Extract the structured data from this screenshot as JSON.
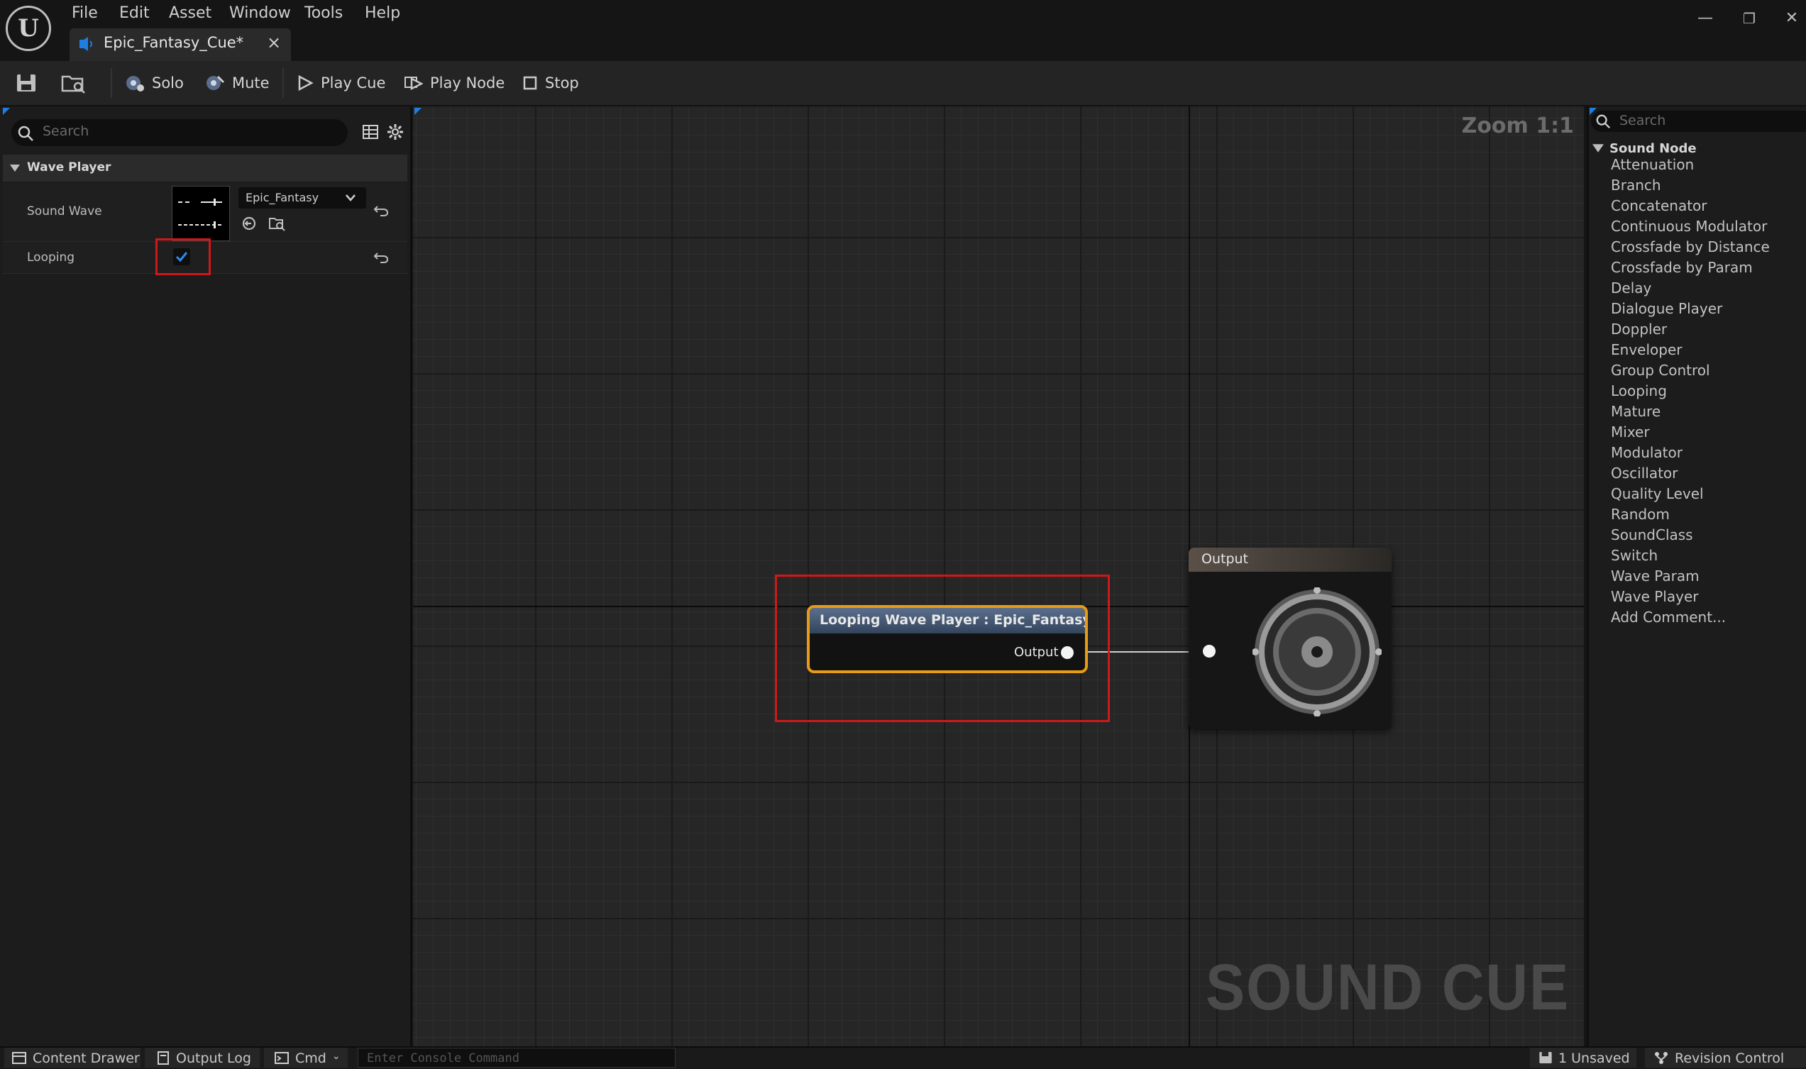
{
  "window": {
    "tab_title": "Epic_Fantasy_Cue*",
    "tab_close": "×",
    "controls": {
      "minimize": "—",
      "restore": "❐",
      "close": "✕"
    }
  },
  "menu": [
    "File",
    "Edit",
    "Asset",
    "Window",
    "Tools",
    "Help"
  ],
  "toolbar": {
    "solo": "Solo",
    "mute": "Mute",
    "play_cue": "Play Cue",
    "play_node": "Play Node",
    "stop": "Stop"
  },
  "details": {
    "search_placeholder": "Search",
    "section": "Wave Player",
    "sound_wave_label": "Sound Wave",
    "sound_wave_value": "Epic_Fantasy",
    "looping_label": "Looping",
    "looping_checked": true
  },
  "graph": {
    "zoom": "Zoom 1:1",
    "watermark": "SOUND CUE",
    "wave_node_title": "Looping Wave Player : Epic_Fantasy",
    "wave_node_output": "Output",
    "output_node_title": "Output"
  },
  "palette": {
    "search_placeholder": "Search",
    "category": "Sound Node",
    "items": [
      "Attenuation",
      "Branch",
      "Concatenator",
      "Continuous Modulator",
      "Crossfade by Distance",
      "Crossfade by Param",
      "Delay",
      "Dialogue Player",
      "Doppler",
      "Enveloper",
      "Group Control",
      "Looping",
      "Mature",
      "Mixer",
      "Modulator",
      "Oscillator",
      "Quality Level",
      "Random",
      "SoundClass",
      "Switch",
      "Wave Param",
      "Wave Player",
      "Add Comment..."
    ]
  },
  "statusbar": {
    "content_drawer": "Content Drawer",
    "output_log": "Output Log",
    "cmd": "Cmd",
    "console_placeholder": "Enter Console Command",
    "unsaved": "1 Unsaved",
    "revision_control": "Revision Control"
  },
  "colors": {
    "selection_red": "#d01818",
    "node_outline_orange": "#e79b16",
    "accent_blue": "#1f7fe0"
  }
}
